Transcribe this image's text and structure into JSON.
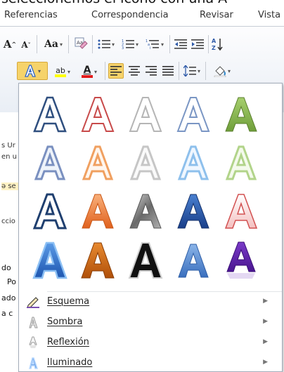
{
  "caption": "seleccionemos el icono con una A",
  "tabs": [
    "Referencias",
    "Correspondencia",
    "Revisar",
    "Vista"
  ],
  "ribbon": {
    "grow_font": "A",
    "shrink_font": "A",
    "change_case": "Aa",
    "highlight_label": "ab",
    "font_color_label": "A",
    "text_effects_label": "A"
  },
  "gallery": {
    "styles": [
      "Relleno blanco, contorno azul",
      "Relleno blanco, contorno rojo",
      "Relleno blanco, contorno gris",
      "Relleno blanco, contorno azul claro",
      "Relleno verde",
      "Contorno azul, sombra",
      "Contorno naranja, sombra",
      "Contorno gris, sombra",
      "Contorno azul claro, sombra",
      "Contorno verde, sombra",
      "Contorno azul oscuro",
      "Relleno naranja degradado",
      "Relleno gris degradado",
      "Relleno azul degradado",
      "Relleno rojo claro",
      "Azul brillante",
      "Naranja oscuro",
      "Negro",
      "Azul claro reflejo",
      "Morado reflejo"
    ],
    "menu": [
      {
        "label": "Esquema",
        "icon": "pencil-outline-icon"
      },
      {
        "label": "Sombra",
        "icon": "shadow-icon"
      },
      {
        "label": "Reflexión",
        "icon": "reflection-icon"
      },
      {
        "label": "Iluminado",
        "icon": "glow-icon"
      }
    ]
  },
  "doc_fragments": [
    "s Ur",
    "en u",
    "ə se",
    "ccio",
    "do",
    "Po",
    "ado",
    "a c"
  ],
  "colors": {
    "ribbon_active": "#f6d36a",
    "highlight_yellow": "#ffff00",
    "font_red": "#e21b1b"
  }
}
